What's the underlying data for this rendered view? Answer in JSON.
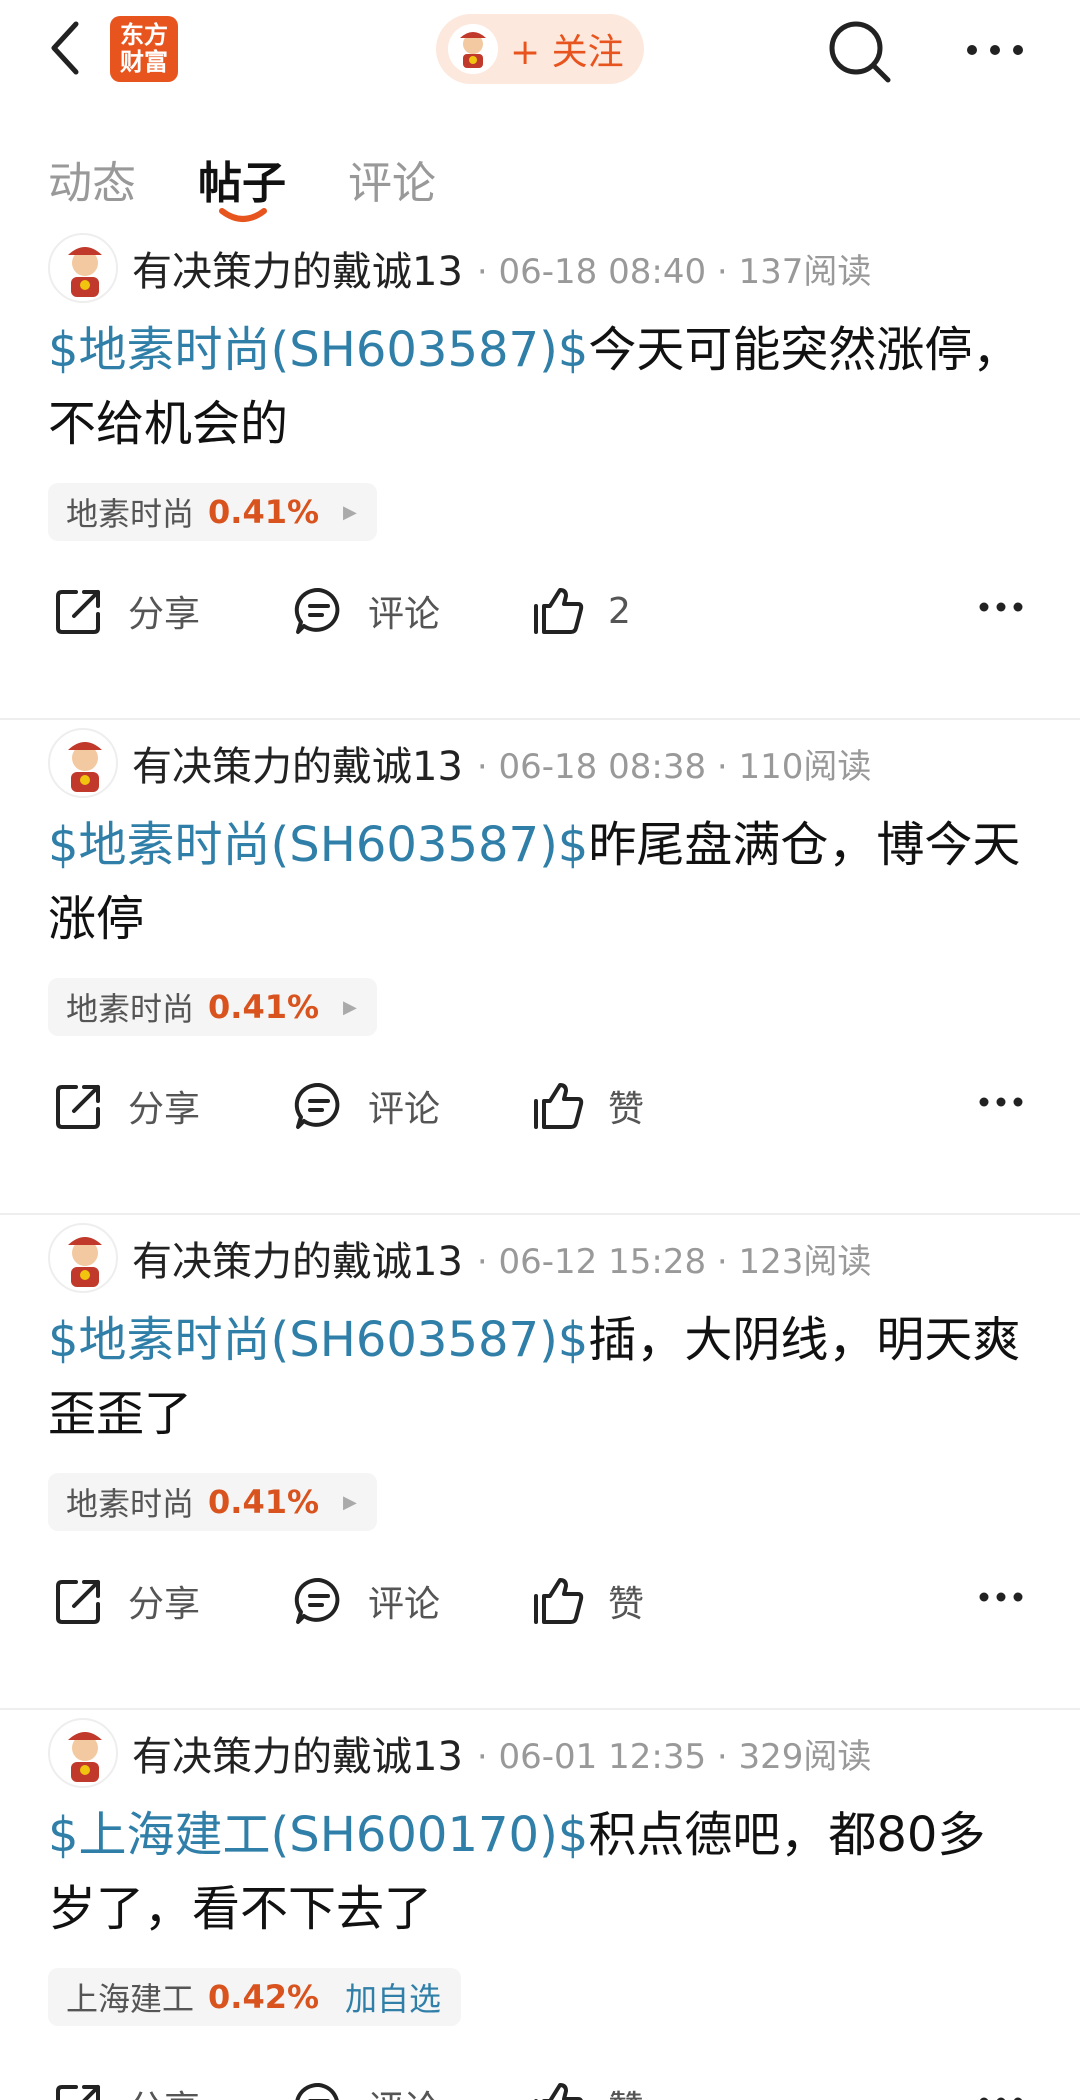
{
  "header": {
    "logo_text": "东方财富",
    "follow_label": "+ 关注"
  },
  "tabs": [
    {
      "label": "动态"
    },
    {
      "label": "帖子"
    },
    {
      "label": "评论"
    }
  ],
  "colors": {
    "accent": "#e8541e",
    "stock_link": "#2f7fa8",
    "change_up": "#d9531e"
  },
  "posts": [
    {
      "author": "有决策力的戴诚13",
      "meta": "· 06-18 08:40 · 137阅读",
      "stock_tag": "$地素时尚(SH603587)$",
      "text": "今天可能突然涨停，不给机会的",
      "chip_name": "地素时尚",
      "chip_pct": "0.41%",
      "chip_extra": "",
      "share": "分享",
      "comment": "评论",
      "like": "2"
    },
    {
      "author": "有决策力的戴诚13",
      "meta": "· 06-18 08:38 · 110阅读",
      "stock_tag": "$地素时尚(SH603587)$",
      "text": "昨尾盘满仓，博今天涨停",
      "chip_name": "地素时尚",
      "chip_pct": "0.41%",
      "chip_extra": "",
      "share": "分享",
      "comment": "评论",
      "like": "赞"
    },
    {
      "author": "有决策力的戴诚13",
      "meta": "· 06-12 15:28 · 123阅读",
      "stock_tag": "$地素时尚(SH603587)$",
      "text": "插，大阴线，明天爽歪歪了",
      "chip_name": "地素时尚",
      "chip_pct": "0.41%",
      "chip_extra": "",
      "share": "分享",
      "comment": "评论",
      "like": "赞"
    },
    {
      "author": "有决策力的戴诚13",
      "meta": "· 06-01 12:35 · 329阅读",
      "stock_tag": "$上海建工(SH600170)$",
      "text": "积点德吧，都80多岁了，看不下去了",
      "chip_name": "上海建工",
      "chip_pct": "0.42%",
      "chip_extra": "加自选",
      "share": "分享",
      "comment": "评论",
      "like": "赞"
    }
  ]
}
